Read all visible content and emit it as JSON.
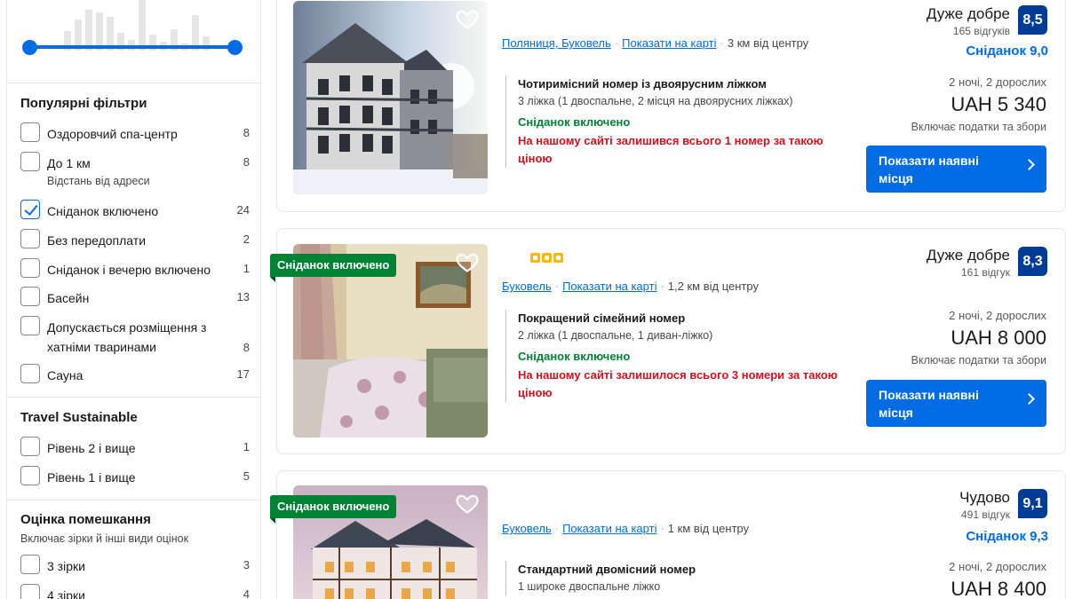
{
  "sidebar": {
    "popular": {
      "title": "Популярні фільтри",
      "items": [
        {
          "label": "Оздоровчий спа-центр",
          "count": "8",
          "checked": false
        },
        {
          "label": "До 1 км",
          "count": "8",
          "checked": false,
          "note": "Відстань від адреси"
        },
        {
          "label": "Сніданок включено",
          "count": "24",
          "checked": true
        },
        {
          "label": "Без передоплати",
          "count": "2",
          "checked": false
        },
        {
          "label": "Сніданок і вечерю включено",
          "count": "1",
          "checked": false
        },
        {
          "label": "Басейн",
          "count": "13",
          "checked": false
        },
        {
          "label_line1": "Допускається розміщення з",
          "label_line2": "хатніми тваринами",
          "count": "8",
          "checked": false
        },
        {
          "label": "Сауна",
          "count": "17",
          "checked": false
        }
      ]
    },
    "sustainable": {
      "title": "Travel Sustainable",
      "items": [
        {
          "label": "Рівень 2 і вище",
          "count": "1"
        },
        {
          "label": "Рівень 1 і вище",
          "count": "5"
        }
      ]
    },
    "rating": {
      "title": "Оцінка помешкання",
      "subtitle": "Включає зірки й інші види оцінок",
      "items": [
        {
          "label": "3 зірки",
          "count": "3"
        },
        {
          "label": "4 зірки",
          "count": "4"
        }
      ]
    }
  },
  "cards": [
    {
      "location": "Поляниця, Буковель",
      "map_link": "Показати на карті",
      "distance": "3 км від центру",
      "room_name": "Чотиримісний номер із двоярусним ліжком",
      "beds": "3 ліжка (1 двоспальне, 2 місця на двоярусних ліжках)",
      "breakfast": "Сніданок включено",
      "warning": "На нашому сайті залишився всього 1 номер за такою ціною",
      "rating_word": "Дуже добре",
      "reviews": "165 відгуків",
      "score": "8,5",
      "breakfast_score": "Сніданок 9,0",
      "nights": "2 ночі, 2 дорослих",
      "price": "UAH 5 340",
      "taxes": "Включає податки та збори",
      "button": "Показати наявні місця"
    },
    {
      "badge": "Сніданок включено",
      "location": "Буковель",
      "map_link": "Показати на карті",
      "distance": "1,2 км від центру",
      "room_name": "Покращений сімейний номер",
      "beds": "2 ліжка (1 двоспальне, 1 диван-ліжко)",
      "breakfast": "Сніданок включено",
      "warning": "На нашому сайті залишилося всього 3 номери за такою ціною",
      "rating_word": "Дуже добре",
      "reviews": "161 відгук",
      "score": "8,3",
      "nights": "2 ночі, 2 дорослих",
      "price": "UAH 8 000",
      "taxes": "Включає податки та збори",
      "button": "Показати наявні місця"
    },
    {
      "badge": "Сніданок включено",
      "location": "Буковель",
      "map_link": "Показати на карті",
      "distance": "1 км від центру",
      "room_name": "Стандартний двомісний номер",
      "beds": "1 широке двоспальне ліжко",
      "rating_word": "Чудово",
      "reviews": "491 відгук",
      "score": "9,1",
      "breakfast_score": "Сніданок 9,3",
      "nights": "2 ночі, 2 дорослих",
      "price": "UAH 8 400"
    }
  ],
  "colors": {
    "primary": "#006ce4",
    "score_bg": "#003b95",
    "success": "#008234",
    "danger": "#d4111e",
    "star": "#ffb700"
  }
}
